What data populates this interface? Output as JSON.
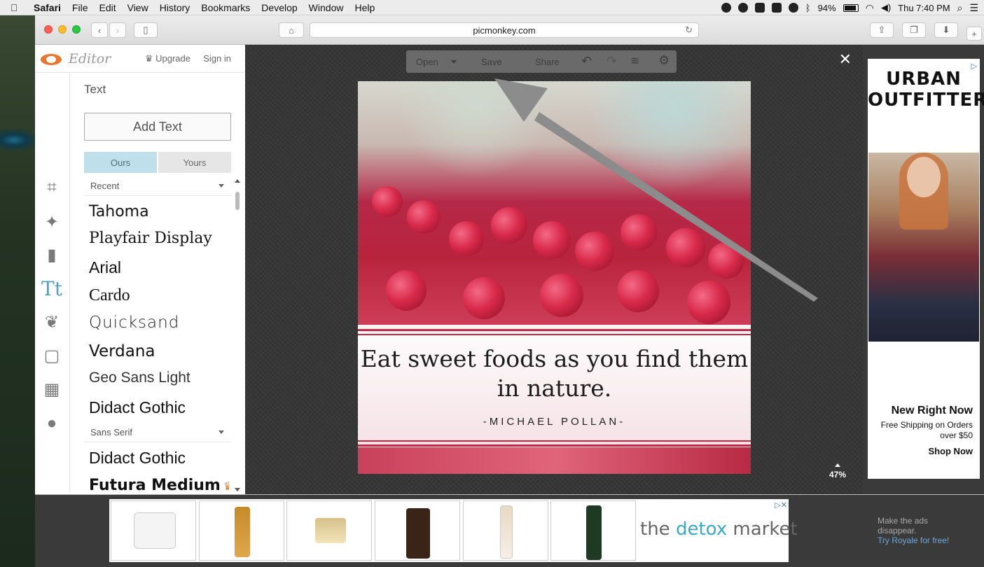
{
  "menubar": {
    "apple": "",
    "items": [
      "Safari",
      "File",
      "Edit",
      "View",
      "History",
      "Bookmarks",
      "Develop",
      "Window",
      "Help"
    ],
    "battery": "94%",
    "clock": "Thu 7:40 PM"
  },
  "browser": {
    "url": "picmonkey.com"
  },
  "editor": {
    "title": "Editor",
    "upgrade": "Upgrade",
    "signin": "Sign in",
    "section": "Text",
    "add_text": "Add Text",
    "tab_ours": "Ours",
    "tab_yours": "Yours",
    "dropdown_recent": "Recent",
    "dropdown_sans": "Sans Serif",
    "fonts_recent": [
      "Tahoma",
      "Playfair Display",
      "Arial",
      "Cardo",
      "Quicksand",
      "Verdana",
      "Geo Sans Light",
      "Didact Gothic"
    ],
    "fonts_sans": [
      "Didact Gothic",
      "Futura Medium"
    ],
    "tool_text_glyph": "Tt"
  },
  "canvas": {
    "toolbar": {
      "open": "Open",
      "save": "Save",
      "share": "Share"
    },
    "close": "✕",
    "zoom": "47%",
    "quote": "Eat sweet foods as you find them in nature.",
    "author": "-MICHAEL POLLAN-"
  },
  "right_ad": {
    "brand_line1": "URBAN",
    "brand_line2": "OUTFITTERS",
    "headline": "New Right Now",
    "sub": "Free Shipping on Orders over $50",
    "cta": "Shop Now"
  },
  "bottom_ad": {
    "brand_pre": "the ",
    "brand_hl": "detox",
    "brand_post": " market"
  },
  "promo": {
    "line1": "Make the ads",
    "line2": "disappear.",
    "link": "Try Royale for free!"
  }
}
